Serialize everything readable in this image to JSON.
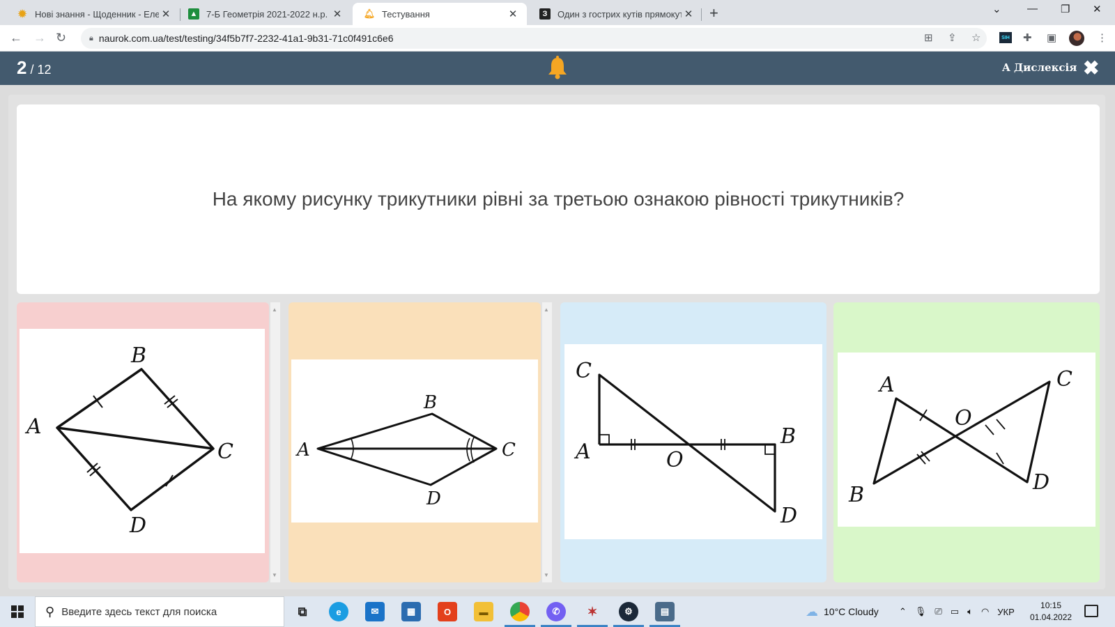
{
  "browser": {
    "tabs": [
      {
        "title": "Нові знання - Щоденник - Елек",
        "icon": "sun-icon",
        "active": false
      },
      {
        "title": "7-Б Геометрія 2021-2022 н.р.",
        "icon": "classroom-icon",
        "active": false
      },
      {
        "title": "Тестування",
        "icon": "bell-icon",
        "active": true
      },
      {
        "title": "Один з гострих кутів прямокут",
        "icon": "znanija-icon",
        "active": false
      }
    ],
    "url": "naurok.com.ua/test/testing/34f5b7f7-2232-41a1-9b31-71c0f491c6e6"
  },
  "header": {
    "current": "2",
    "total": "/ 12",
    "dyslexia_label": "A Дислексія",
    "bg_color": "#435a6e",
    "bell_color": "#f5a623"
  },
  "question": {
    "text": "На якому рисунку трикутники рівні за третьою ознакою рівності трикутників?"
  },
  "answers": [
    {
      "color": "#f7cfcf",
      "labels": {
        "A": "A",
        "B": "B",
        "C": "C",
        "D": "D"
      }
    },
    {
      "color": "#fae0ba",
      "labels": {
        "A": "A",
        "B": "B",
        "C": "C",
        "D": "D"
      }
    },
    {
      "color": "#d6ebf8",
      "labels": {
        "A": "A",
        "B": "B",
        "C": "C",
        "D": "D",
        "O": "O"
      }
    },
    {
      "color": "#d9f7c9",
      "labels": {
        "A": "A",
        "B": "B",
        "C": "C",
        "D": "D",
        "O": "O"
      }
    }
  ],
  "taskbar": {
    "search_placeholder": "Введите здесь текст для поиска",
    "weather": "10°C  Cloudy",
    "language": "УКР",
    "time": "10:15",
    "date": "01.04.2022"
  }
}
